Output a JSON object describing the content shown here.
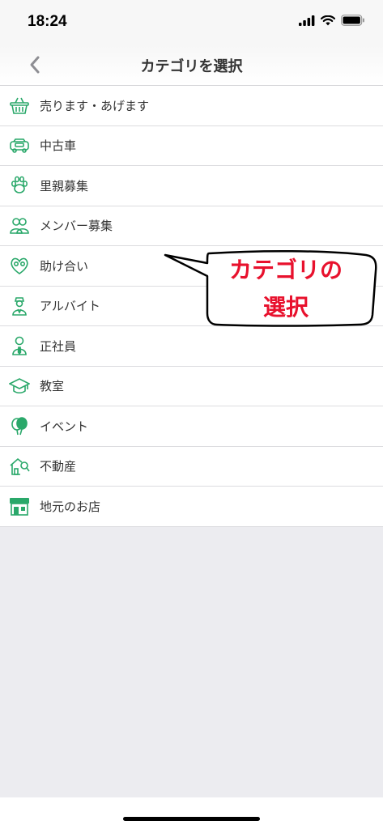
{
  "status_bar": {
    "time": "18:24"
  },
  "nav": {
    "title": "カテゴリを選択"
  },
  "categories": [
    {
      "label": "売ります・あげます",
      "icon": "basket-icon"
    },
    {
      "label": "中古車",
      "icon": "car-icon"
    },
    {
      "label": "里親募集",
      "icon": "paw-icon"
    },
    {
      "label": "メンバー募集",
      "icon": "people-icon"
    },
    {
      "label": "助け合い",
      "icon": "heart-hands-icon"
    },
    {
      "label": "アルバイト",
      "icon": "worker-icon"
    },
    {
      "label": "正社員",
      "icon": "employee-icon"
    },
    {
      "label": "教室",
      "icon": "graduation-cap-icon"
    },
    {
      "label": "イベント",
      "icon": "balloon-icon"
    },
    {
      "label": "不動産",
      "icon": "house-search-icon"
    },
    {
      "label": "地元のお店",
      "icon": "shop-icon"
    }
  ],
  "callout": {
    "line1": "カテゴリの",
    "line2": "選択"
  },
  "colors": {
    "accent": "#2aa86a",
    "callout_text": "#e8112d"
  }
}
